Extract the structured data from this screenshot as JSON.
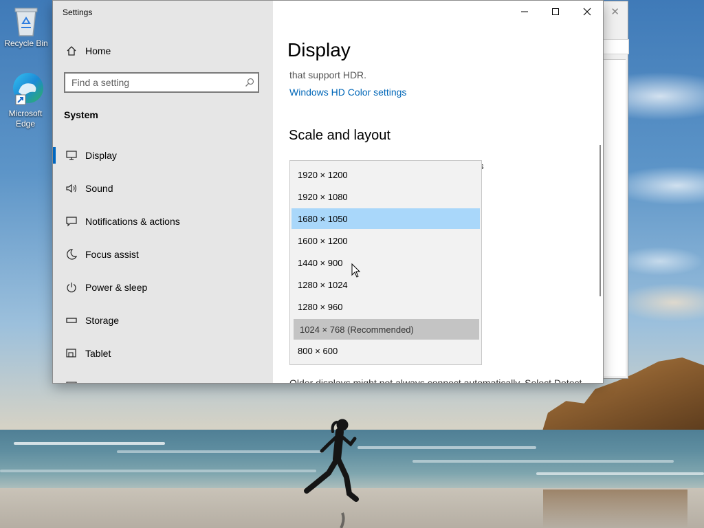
{
  "desktop": {
    "icons": [
      {
        "name": "Recycle Bin"
      },
      {
        "name": "Microsoft Edge"
      }
    ]
  },
  "settings": {
    "title": "Settings",
    "controls": {
      "minimize": "minimize-icon",
      "maximize": "maximize-icon",
      "close": "close-icon"
    },
    "nav": {
      "home": "Home",
      "search_placeholder": "Find a setting",
      "group": "System",
      "items": [
        {
          "label": "Display",
          "icon": "monitor-icon",
          "selected": true
        },
        {
          "label": "Sound",
          "icon": "speaker-icon"
        },
        {
          "label": "Notifications & actions",
          "icon": "message-icon"
        },
        {
          "label": "Focus assist",
          "icon": "moon-icon"
        },
        {
          "label": "Power & sleep",
          "icon": "power-icon"
        },
        {
          "label": "Storage",
          "icon": "storage-icon"
        },
        {
          "label": "Tablet",
          "icon": "tablet-icon"
        }
      ]
    },
    "content": {
      "page_title": "Display",
      "hdr_text": "that support HDR.",
      "hdr_link": "Windows HD Color settings",
      "section_title": "Scale and layout",
      "trailing_char": "s",
      "footer_text": "Older displays might not always connect automatically. Select Detect"
    },
    "resolution_dropdown": {
      "options": [
        "1920 × 1200",
        "1920 × 1080",
        "1680 × 1050",
        "1600 × 1200",
        "1440 × 900",
        "1280 × 1024",
        "1280 × 960",
        "1024 × 768 (Recommended)",
        "800 × 600"
      ],
      "hovered": "1680 × 1050",
      "selected": "1024 × 768 (Recommended)"
    }
  },
  "colors": {
    "accent": "#0067c0",
    "link": "#0067b8",
    "hover": "#a9d7fa",
    "selected": "#c4c4c4",
    "nav_bg": "#e6e6e6"
  }
}
